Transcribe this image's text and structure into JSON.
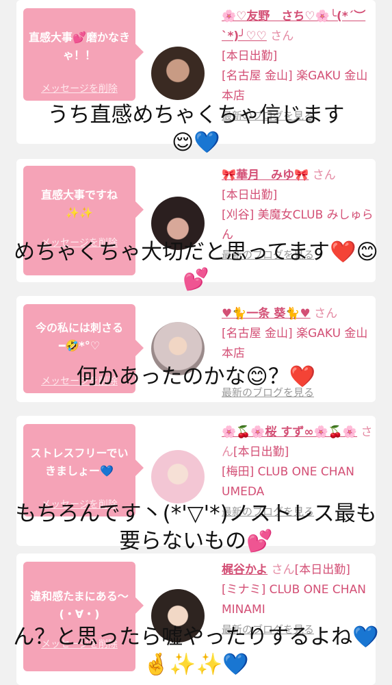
{
  "cards": [
    {
      "bubble_text": "直感大事💕磨かなきゃ！！",
      "delete_label": "メッセージを削除",
      "name": "🌸♡友野　さち♡🌸╰(*´︶`*)╯♡♡",
      "honorific": "さん",
      "status": "[本日出勤]",
      "shop": "[名古屋 金山] 楽GAKU 金山本店",
      "blog_label": "最新のブログを見る",
      "avatar_color": "#3a2a22"
    },
    {
      "bubble_text": "直感大事ですね\n✨✨",
      "delete_label": "メッセージを削除",
      "name": "🎀華月　みゆ🎀",
      "honorific": "さん",
      "status": "[本日出勤]",
      "shop": "[刈谷] 美魔女CLUB みしゅらん",
      "blog_label": "最新のブログを見る",
      "avatar_color": "#2b1f1f"
    },
    {
      "bubble_text": "今の私には刺さる\n━🤣*°♡",
      "delete_label": "メッセージを削除",
      "name": "♥🐈一条 葵🐈♥",
      "honorific": "さん",
      "status": "",
      "shop": "[名古屋 金山] 楽GAKU 金山本店",
      "blog_label": "最新のブログを見る",
      "avatar_color": "#c9b9b9"
    },
    {
      "bubble_text": "ストレスフリーでいきましょー💙",
      "delete_label": "メッセージを削除",
      "name": "🌸🍒🌸桜 すず∞🌸🍒🌸",
      "honorific": "さん",
      "status": "[本日出勤]",
      "shop": "[梅田] CLUB ONE CHAN UMEDA",
      "blog_label": "最新のブログを見る",
      "avatar_color": "#f3c6d4"
    },
    {
      "bubble_text": "違和感たまにある〜(・∀・)",
      "delete_label": "メッセージを削除",
      "name": "梶谷かよ",
      "honorific": "さん",
      "status": "[本日出勤]",
      "shop": "[ミナミ] CLUB ONE CHAN MINAMI",
      "blog_label": "最新のブログを見る",
      "avatar_color": "#2e2420"
    }
  ],
  "overlays": [
    "うち直感めちゃくちゃ信じます\n😌💙",
    "めちゃくちゃ大切だと思ってます❤️😊💕",
    "何かあったのかな😊？❤️",
    "もちろんです丶(*'▽'*)ノストレス最も要らないもの💕",
    "ん？と思ったら嘘やったりするよね💙🤞✨✨💙"
  ]
}
